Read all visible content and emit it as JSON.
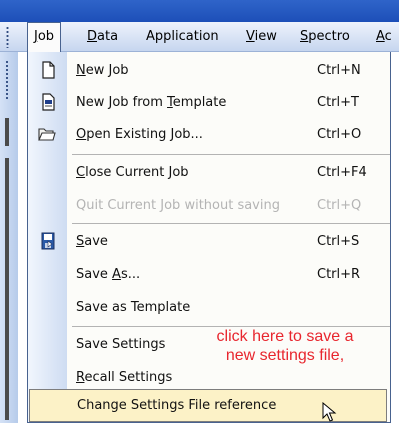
{
  "menubar": {
    "items": [
      {
        "label": "Job",
        "mnemonic": "J",
        "rest": "ob",
        "active": true
      },
      {
        "label": "Data",
        "mnemonic": "D",
        "rest": "ata"
      },
      {
        "label": "Application",
        "mnemonic": "",
        "rest": "Application"
      },
      {
        "label": "View",
        "mnemonic": "V",
        "rest": "iew"
      },
      {
        "label": "Spectro",
        "mnemonic": "S",
        "rest": "pectro"
      },
      {
        "label": "Ac",
        "mnemonic": "A",
        "rest": "c"
      }
    ]
  },
  "job_menu": {
    "items": [
      {
        "pre": "",
        "mn": "N",
        "post": "ew Job",
        "shortcut": "Ctrl+N",
        "icon": "new-document-icon"
      },
      {
        "pre": "New Job from ",
        "mn": "T",
        "post": "emplate",
        "shortcut": "Ctrl+T",
        "icon": "template-document-icon"
      },
      {
        "pre": "",
        "mn": "O",
        "post": "pen Existing Job...",
        "shortcut": "Ctrl+O",
        "icon": "open-folder-icon"
      },
      {
        "pre": "",
        "mn": "C",
        "post": "lose Current Job",
        "shortcut": "Ctrl+F4"
      },
      {
        "pre": "Quit Current Job without saving",
        "mn": "",
        "post": "",
        "shortcut": "Ctrl+Q",
        "disabled": true
      },
      {
        "pre": "",
        "mn": "S",
        "post": "ave",
        "shortcut": "Ctrl+S",
        "icon": "save-icon"
      },
      {
        "pre": "Save ",
        "mn": "A",
        "post": "s...",
        "shortcut": "Ctrl+R"
      },
      {
        "pre": "Save as Template",
        "mn": "",
        "post": "",
        "shortcut": ""
      },
      {
        "pre": "Save Settings",
        "mn": "",
        "post": "",
        "shortcut": ""
      },
      {
        "pre": "",
        "mn": "R",
        "post": "ecall Settings",
        "shortcut": ""
      },
      {
        "pre": "Change Settings File reference",
        "mn": "",
        "post": "",
        "shortcut": "",
        "highlighted": true
      }
    ]
  },
  "annotation": {
    "line1": "click here to save a",
    "line2": "new settings file,",
    "color": "#e8262e"
  },
  "colors": {
    "highlight": "#fcf2c7",
    "menu_border": "#48628f",
    "disabled_text": "#b4b4b4"
  }
}
